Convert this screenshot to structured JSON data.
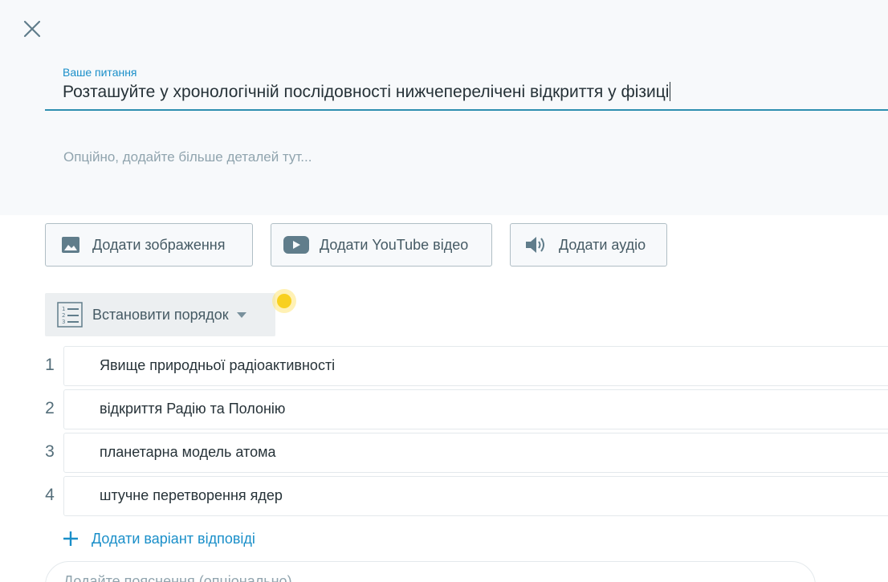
{
  "question": {
    "label": "Ваше питання",
    "value": "Розташуйте у хронологічній послідовності нижчеперелічені відкриття у фізиці",
    "details_placeholder": "Опційно, додайте більше деталей тут..."
  },
  "media": {
    "image_label": "Додати зображення",
    "youtube_label": "Додати YouTube відео",
    "audio_label": "Додати аудіо"
  },
  "question_type": {
    "selected": "Встановити порядок"
  },
  "answers": [
    {
      "number": "1",
      "text": "Явище природньої радіоактивності"
    },
    {
      "number": "2",
      "text": "відкриття Радію та Полонію"
    },
    {
      "number": "3",
      "text": "планетарна модель атома"
    },
    {
      "number": "4",
      "text": "штучне перетворення ядер"
    }
  ],
  "add_answer_label": "Додати варіант відповіді",
  "explanation_placeholder": "Додайте пояснення (опціонально)",
  "colors": {
    "accent": "#1a8fc9",
    "underline": "#2e8fb0",
    "panel_bg": "#f7f9fb",
    "text": "#263238",
    "muted": "#90a4ae"
  },
  "icons": {
    "close": "close-icon",
    "image": "image-icon",
    "youtube": "youtube-icon",
    "audio": "volume-icon",
    "order": "numbered-list-icon",
    "dropdown": "caret-down-icon",
    "add": "plus-icon"
  }
}
